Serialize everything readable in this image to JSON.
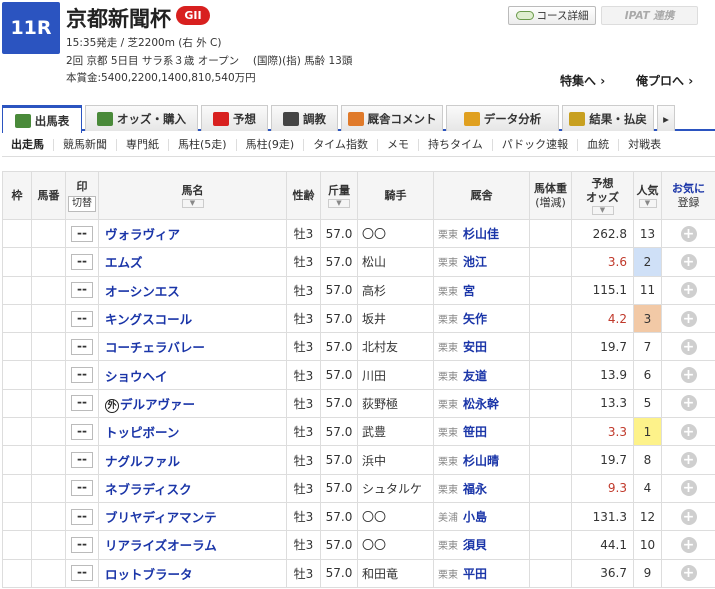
{
  "race": {
    "number": "11R",
    "title": "京都新聞杯",
    "grade": "GII",
    "line1": "15:35発走 / 芝2200m (右 外 C)",
    "line2": "2回 京都 5日目 サラ系３歳 オープン　 (国際)(指) 馬齢 13頭",
    "line3": "本賞金:5400,2200,1400,810,540万円"
  },
  "buttons": {
    "course": "コース詳細",
    "ipat": "IPAT 連携"
  },
  "links": {
    "special": "特集へ",
    "ore": "俺プロへ"
  },
  "tabs": [
    {
      "label": "出馬表",
      "color": "#4a8a3a"
    },
    {
      "label": "オッズ・購入",
      "color": "#4a8a3a"
    },
    {
      "label": "予想",
      "color": "#d8201f"
    },
    {
      "label": "調教",
      "color": "#444444"
    },
    {
      "label": "厩舎コメント",
      "color": "#e07a2a"
    },
    {
      "label": "データ分析",
      "color": "#e0a020"
    },
    {
      "label": "結果・払戻",
      "color": "#c8a020"
    }
  ],
  "subtabs": [
    "出走馬",
    "競馬新聞",
    "専門紙",
    "馬柱(5走)",
    "馬柱(9走)",
    "タイム指数",
    "メモ",
    "持ちタイム",
    "パドック速報",
    "血統",
    "対戦表"
  ],
  "headers": {
    "waku": "枠",
    "umaban": "馬番",
    "mark": "印",
    "mark_switch": "切替",
    "horse": "馬名",
    "sexage": "性齢",
    "weight": "斤量",
    "jockey": "騎手",
    "trainer": "厩舎",
    "bodyweight": "馬体重",
    "bodyweight_sub": "(増減)",
    "odds": "予想",
    "odds_sub": "オッズ",
    "pop": "人気",
    "fav": "お気に",
    "fav_sub": "登録"
  },
  "mark_placeholder": "--",
  "gaikoku_mark": "外",
  "rows": [
    {
      "horse": "ヴォラヴィア",
      "sexage": "牡3",
      "weight": "57.0",
      "jockey": "〇〇",
      "area": "栗東",
      "trainer": "杉山佳",
      "odds": "262.8",
      "odds_color": "#333333",
      "pop": "13",
      "pop_bg": "#ffffff"
    },
    {
      "horse": "エムズ",
      "sexage": "牡3",
      "weight": "57.0",
      "jockey": "松山",
      "area": "栗東",
      "trainer": "池江",
      "odds": "3.6",
      "odds_color": "#c0392b",
      "pop": "2",
      "pop_bg": "#cfe0f7"
    },
    {
      "horse": "オーシンエス",
      "sexage": "牡3",
      "weight": "57.0",
      "jockey": "高杉",
      "area": "栗東",
      "trainer": "宮",
      "odds": "115.1",
      "odds_color": "#333333",
      "pop": "11",
      "pop_bg": "#ffffff"
    },
    {
      "horse": "キングスコール",
      "sexage": "牡3",
      "weight": "57.0",
      "jockey": "坂井",
      "area": "栗東",
      "trainer": "矢作",
      "odds": "4.2",
      "odds_color": "#c0392b",
      "pop": "3",
      "pop_bg": "#f2c9a6"
    },
    {
      "horse": "コーチェラバレー",
      "sexage": "牡3",
      "weight": "57.0",
      "jockey": "北村友",
      "area": "栗東",
      "trainer": "安田",
      "odds": "19.7",
      "odds_color": "#333333",
      "pop": "7",
      "pop_bg": "#ffffff"
    },
    {
      "horse": "ショウヘイ",
      "sexage": "牡3",
      "weight": "57.0",
      "jockey": "川田",
      "area": "栗東",
      "trainer": "友道",
      "odds": "13.9",
      "odds_color": "#333333",
      "pop": "6",
      "pop_bg": "#ffffff"
    },
    {
      "horse": "デルアヴァー",
      "gaikoku": true,
      "sexage": "牡3",
      "weight": "57.0",
      "jockey": "荻野極",
      "area": "栗東",
      "trainer": "松永幹",
      "odds": "13.3",
      "odds_color": "#333333",
      "pop": "5",
      "pop_bg": "#ffffff"
    },
    {
      "horse": "トッピボーン",
      "sexage": "牡3",
      "weight": "57.0",
      "jockey": "武豊",
      "area": "栗東",
      "trainer": "笹田",
      "odds": "3.3",
      "odds_color": "#c0392b",
      "pop": "1",
      "pop_bg": "#fdf28a"
    },
    {
      "horse": "ナグルファル",
      "sexage": "牡3",
      "weight": "57.0",
      "jockey": "浜中",
      "area": "栗東",
      "trainer": "杉山晴",
      "odds": "19.7",
      "odds_color": "#333333",
      "pop": "8",
      "pop_bg": "#ffffff"
    },
    {
      "horse": "ネブラディスク",
      "sexage": "牡3",
      "weight": "57.0",
      "jockey": "シュタルケ",
      "area": "栗東",
      "trainer": "福永",
      "odds": "9.3",
      "odds_color": "#c0392b",
      "pop": "4",
      "pop_bg": "#ffffff"
    },
    {
      "horse": "ブリヤディアマンテ",
      "sexage": "牡3",
      "weight": "57.0",
      "jockey": "〇〇",
      "area": "美浦",
      "trainer": "小島",
      "odds": "131.3",
      "odds_color": "#333333",
      "pop": "12",
      "pop_bg": "#ffffff"
    },
    {
      "horse": "リアライズオーラム",
      "sexage": "牡3",
      "weight": "57.0",
      "jockey": "〇〇",
      "area": "栗東",
      "trainer": "須貝",
      "odds": "44.1",
      "odds_color": "#333333",
      "pop": "10",
      "pop_bg": "#ffffff"
    },
    {
      "horse": "ロットブラータ",
      "sexage": "牡3",
      "weight": "57.0",
      "jockey": "和田竜",
      "area": "栗東",
      "trainer": "平田",
      "odds": "36.7",
      "odds_color": "#333333",
      "pop": "9",
      "pop_bg": "#ffffff"
    }
  ]
}
